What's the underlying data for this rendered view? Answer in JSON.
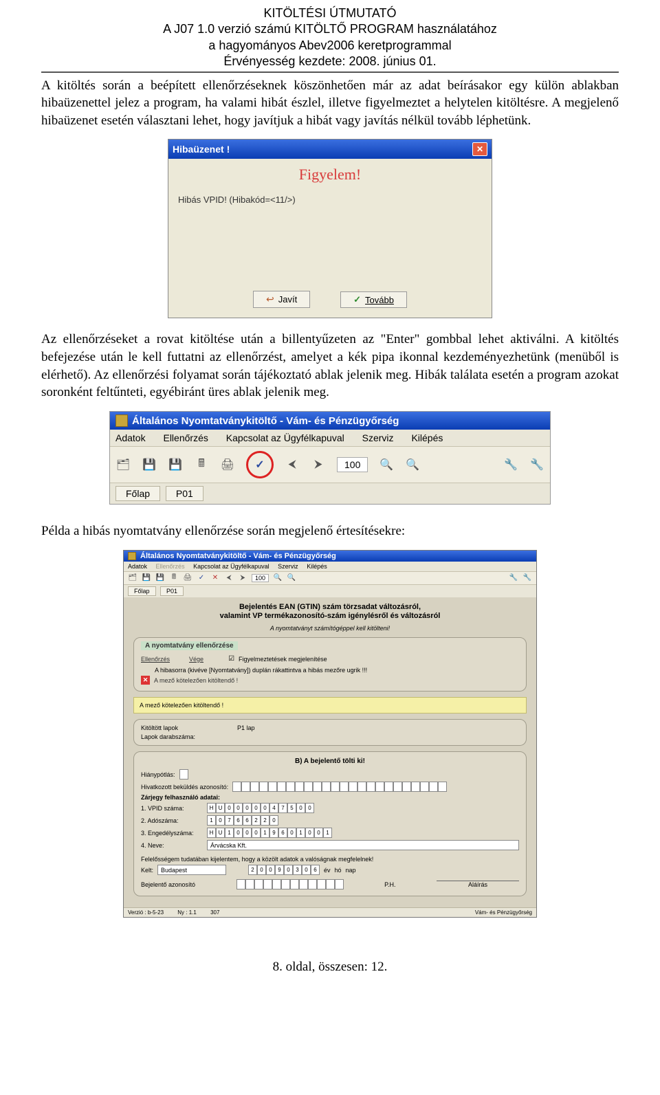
{
  "header": {
    "l1": "KITÖLTÉSI ÚTMUTATÓ",
    "l2": "A J07 1.0 verzió számú KITÖLTŐ PROGRAM használatához",
    "l3": "a hagyományos Abev2006 keretprogrammal",
    "l4": "Érvényesség kezdete: 2008. június 01."
  },
  "p1": "A kitöltés során a beépített ellenőrzéseknek köszönhetően már az adat beírásakor egy külön ablakban hibaüzenettel jelez a program, ha valami hibát észlel, illetve figyelmeztet a helytelen kitöltésre. A megjelenő hibaüzenet esetén választani lehet, hogy javítjuk a hibát vagy javítás nélkül tovább léphetünk.",
  "dialog": {
    "title": "Hibaüzenet !",
    "close_icon_label": "✕",
    "warning": "Figyelem!",
    "message": "Hibás VPID! (Hibakód=<11/>)",
    "btn_fix": "Javít",
    "btn_next": "Tovább"
  },
  "p2": "Az ellenőrzéseket a rovat kitöltése után a billentyűzeten az \"Enter\" gombbal lehet aktiválni. A kitöltés befejezése után le kell futtatni az ellenőrzést, amelyet a kék pipa ikonnal kezdeményezhetünk (menüből is elérhető). Az ellenőrzési folyamat során tájékoztató ablak jelenik meg. Hibák találata esetén a program azokat soronként feltűnteti, egyébiránt üres ablak jelenik meg.",
  "app": {
    "title": "Általános Nyomtatványkitöltő - Vám- és Pénzügyőrség",
    "menu": [
      "Adatok",
      "Ellenőrzés",
      "Kapcsolat az Ügyfélkapuval",
      "Szerviz",
      "Kilépés"
    ],
    "zoom": "100",
    "tabs": [
      "Főlap",
      "P01"
    ]
  },
  "p3": "Példa a hibás nyomtatvány ellenőrzése során megjelenő értesítésekre:",
  "form": {
    "title": "Általános Nyomtatványkitöltő - Vám- és Pénzügyőrség",
    "menu": [
      "Adatok",
      "Ellenőrzés",
      "Kapcsolat az Ügyfélkapuval",
      "Szerviz",
      "Kilépés"
    ],
    "zoom": "100",
    "tabs": [
      "Főlap",
      "P01"
    ],
    "heading1": "Bejelentés EAN (GTIN) szám törzsadat változásról,",
    "heading2": "valamint VP termékazonosító-szám igénylésről és változásról",
    "italic": "A nyomtatványt számítógéppel kell kitölteni!",
    "check_box": {
      "title": "A nyomtatvány ellenőrzése",
      "ell": "Ellenőrzés",
      "vege": "Vége",
      "cb": "Figyelmeztetések megjelenítése",
      "note": "A hibasorra (kivéve [Nyomtatvány]) duplán rákattintva a hibás mezőre ugrik !!!",
      "err": "A mező kötelezően kitöltendő !"
    },
    "yellow_err": "A mező kötelezően kitöltendő !",
    "kitolt_label": "Kitöltött lapok",
    "kitolt_value": "P1 lap",
    "lapok_label": "Lapok darabszáma:",
    "sectionB": "B) A bejelentő tölti ki!",
    "hianyp": "Hiánypótlás:",
    "hivatk": "Hivatkozott beküldés azonosító:",
    "zarjegy": "Zárjegy felhasználó adatai:",
    "r1_label": "1. VPID száma:",
    "r1_values": [
      "H",
      "U",
      "0",
      "0",
      "0",
      "0",
      "0",
      "4",
      "7",
      "5",
      "0",
      "0"
    ],
    "r2_label": "2. Adószáma:",
    "r2_values": [
      "1",
      "0",
      "7",
      "6",
      "6",
      "2",
      "2",
      "0"
    ],
    "r3_label": "3. Engedélyszáma:",
    "r3_values": [
      "H",
      "U",
      "1",
      "0",
      "0",
      "0",
      "1",
      "9",
      "6",
      "0",
      "1",
      "0",
      "0",
      "1"
    ],
    "r4_label": "4. Neve:",
    "r4_value": "Árvácska Kft.",
    "felelos": "Felelősségem tudatában kijelentem, hogy a közölt adatok a valóságnak megfelelnek!",
    "kelt_label": "Kelt:",
    "kelt_value": "Budapest",
    "date_values": [
      "2",
      "0",
      "0",
      "9",
      "0",
      "3",
      "0",
      "6"
    ],
    "date_suffix": [
      "év",
      "hó",
      "nap"
    ],
    "ph": "P.H.",
    "bejazon": "Bejelentő azonosító",
    "alair": "Aláírás",
    "status_ver": "Verzió : b-5-23",
    "status_ny": "Ny : 1.1",
    "status_num": "307",
    "status_right": "Vám- és Pénzügyőrség"
  },
  "footer": "8. oldal, összesen: 12."
}
